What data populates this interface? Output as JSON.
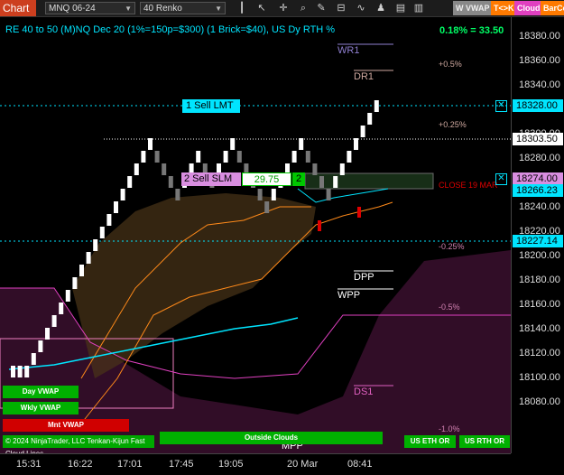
{
  "toolbar": {
    "title": "Chart",
    "instrument": "MNQ 06-24",
    "bar_type": "40 Renko",
    "icons": [
      "bars-icon",
      "pointer-icon",
      "crosshair-icon",
      "zoom-icon",
      "pencil-icon",
      "drawing-objects-icon",
      "indicators-icon",
      "strategies-icon",
      "chart-trader-icon",
      "properties-icon"
    ],
    "buttons": [
      "W VWAP",
      "T<>K",
      "Cloud",
      "BarCo"
    ]
  },
  "header": {
    "description": "RE 40 to 50 (M)NQ Dec 20 (1%=150p=$300) (1 Brick=$40), US Dy RTH %",
    "pnl": "0.18% = 33.50"
  },
  "levels": {
    "wr1": "WR1",
    "dr1": "DR1",
    "dpp": "DPP",
    "wpp": "WPP",
    "ds1": "DS1",
    "mpp": "MPP",
    "pct_plus_05": "+0.5%",
    "pct_plus_025": "+0.25%",
    "pct_minus_025": "-0.25%",
    "pct_minus_05": "-0.5%",
    "pct_minus_1": "-1.0%",
    "close": "CLOSE 19 MAR"
  },
  "orders": {
    "sell_lmt": "1 Sell LMT",
    "sell_slm": "2 Sell SLM",
    "slm_price": "29.75",
    "slm_qty": "2"
  },
  "buttons": {
    "day_vwap": "Day VWAP",
    "wkly_vwap": "Wkly VWAP",
    "mnt_vwap": "Mnt VWAP",
    "outside_clouds": "Outside Clouds",
    "us_eth_or": "US ETH OR",
    "us_rth_or": "US RTH OR"
  },
  "footer_note": "© 2024 NinjaTrader, LLC Tenkan-Kijun Fast Cloud Lines",
  "y_axis": {
    "ticks": [
      "18380.00",
      "18360.00",
      "18340.00",
      "18320.00",
      "18300.00",
      "18280.00",
      "18260.00",
      "18240.00",
      "18220.00",
      "18200.00",
      "18180.00",
      "18160.00",
      "18140.00",
      "18120.00",
      "18100.00",
      "18080.00"
    ],
    "tag_sell_lmt": "18328.00",
    "tag_last": "18303.50",
    "tag_slm": "18274.00",
    "tag_bid": "18266.23",
    "tag_lower": "18227.14"
  },
  "x_axis": {
    "ticks": [
      "15:31",
      "16:22",
      "17:01",
      "17:45",
      "19:05",
      "20 Mar",
      "08:41"
    ]
  },
  "colors": {
    "accent": "#00e5ff",
    "title_bg": "#cc3f1f",
    "green": "#00c800",
    "red": "#e00000",
    "magenta": "#e040c0"
  },
  "renko": [
    {
      "t": "u",
      "c": 0
    },
    {
      "t": "u",
      "c": 0
    },
    {
      "t": "u",
      "c": 0
    },
    {
      "t": "u",
      "c": 1
    },
    {
      "t": "u",
      "c": 2
    },
    {
      "t": "u",
      "c": 3
    },
    {
      "t": "u",
      "c": 4
    },
    {
      "t": "u",
      "c": 5
    },
    {
      "t": "u",
      "c": 6
    },
    {
      "t": "u",
      "c": 7
    },
    {
      "t": "u",
      "c": 8
    },
    {
      "t": "u",
      "c": 9
    },
    {
      "t": "u",
      "c": 10
    },
    {
      "t": "u",
      "c": 11
    },
    {
      "t": "u",
      "c": 12
    },
    {
      "t": "u",
      "c": 13
    },
    {
      "t": "u",
      "c": 14
    },
    {
      "t": "u",
      "c": 15
    },
    {
      "t": "u",
      "c": 16
    },
    {
      "t": "u",
      "c": 17
    },
    {
      "t": "u",
      "c": 18
    },
    {
      "t": "d",
      "c": 17
    },
    {
      "t": "d",
      "c": 16
    },
    {
      "t": "d",
      "c": 15
    },
    {
      "t": "d",
      "c": 14
    },
    {
      "t": "u",
      "c": 15
    },
    {
      "t": "u",
      "c": 16
    },
    {
      "t": "u",
      "c": 17
    },
    {
      "t": "d",
      "c": 16
    },
    {
      "t": "d",
      "c": 15
    },
    {
      "t": "u",
      "c": 16
    },
    {
      "t": "u",
      "c": 17
    },
    {
      "t": "u",
      "c": 18
    },
    {
      "t": "d",
      "c": 17
    },
    {
      "t": "d",
      "c": 16
    },
    {
      "t": "d",
      "c": 15
    },
    {
      "t": "d",
      "c": 14
    },
    {
      "t": "d",
      "c": 13
    },
    {
      "t": "u",
      "c": 14
    },
    {
      "t": "u",
      "c": 15
    },
    {
      "t": "u",
      "c": 16
    },
    {
      "t": "u",
      "c": 17
    },
    {
      "t": "u",
      "c": 18
    },
    {
      "t": "d",
      "c": 17
    },
    {
      "t": "d",
      "c": 16
    },
    {
      "t": "d",
      "c": 15
    },
    {
      "t": "d",
      "c": 14
    },
    {
      "t": "u",
      "c": 15
    },
    {
      "t": "u",
      "c": 16
    },
    {
      "t": "u",
      "c": 17
    },
    {
      "t": "u",
      "c": 18
    },
    {
      "t": "u",
      "c": 19
    },
    {
      "t": "u",
      "c": 20
    },
    {
      "t": "u",
      "c": 21
    }
  ]
}
